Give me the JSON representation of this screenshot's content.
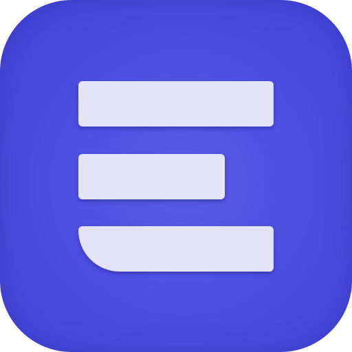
{
  "icon": {
    "name": "stacked-bars-app-icon",
    "background_color": "#4e4ee2",
    "bar_color": "#e4e4f8"
  }
}
